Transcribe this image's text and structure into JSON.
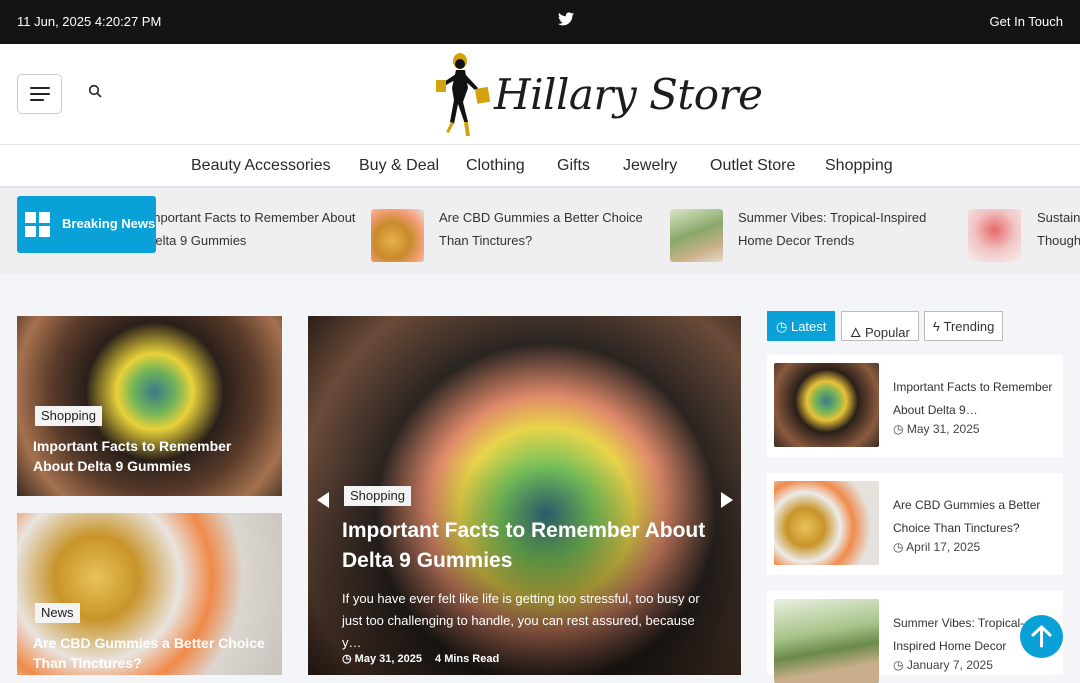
{
  "topbar": {
    "datetime": "11 Jun, 2025 4:20:27 PM",
    "contact": "Get In Touch"
  },
  "header": {
    "logo_text": "Hillary Store"
  },
  "nav": {
    "items": [
      "Beauty Accessories",
      "Buy & Deal",
      "Clothing",
      "Gifts",
      "Jewelry",
      "Outlet Store",
      "Shopping"
    ]
  },
  "ticker": {
    "label": "Breaking News",
    "items": [
      {
        "line1": "Important Facts to Remember About",
        "line2": "Delta 9 Gummies"
      },
      {
        "line1": "Are CBD Gummies a Better Choice",
        "line2": "Than Tinctures?"
      },
      {
        "line1": "Summer Vibes: Tropical-Inspired",
        "line2": "Home Decor Trends"
      },
      {
        "line1": "Sustainable",
        "line2": "Thoughtful"
      }
    ]
  },
  "cards": [
    {
      "tag": "Shopping",
      "title": "Important Facts to Remember About Delta 9 Gummies"
    },
    {
      "tag": "News",
      "title": "Are CBD Gummies a Better Choice Than Tinctures?"
    }
  ],
  "featured": {
    "tag": "Shopping",
    "title": "Important Facts to Remember About Delta 9 Gummies",
    "excerpt": "If you have ever felt like life is getting too stressful, too busy or just too challenging to handle, you can rest assured, because y…",
    "date": "May 31, 2025",
    "read": "4 Mins Read"
  },
  "tabs": {
    "latest": "Latest",
    "popular": "Popular",
    "trending": "Trending"
  },
  "sidebar": [
    {
      "title": "Important Facts to Remember About Delta 9…",
      "date": "May 31, 2025"
    },
    {
      "title": "Are CBD Gummies a Better Choice Than Tinctures?",
      "date": "April 17, 2025"
    },
    {
      "title": "Summer Vibes: Tropical-Inspired Home Decor Trends",
      "date": "January 7, 2025"
    }
  ],
  "colors": {
    "accent": "#0aa1d8",
    "topbar": "#141414"
  },
  "icons": [
    "twitter-icon",
    "menu-icon",
    "search-icon",
    "grid-icon",
    "clock-icon",
    "flame-icon",
    "bolt-icon",
    "arrow-up-icon"
  ]
}
